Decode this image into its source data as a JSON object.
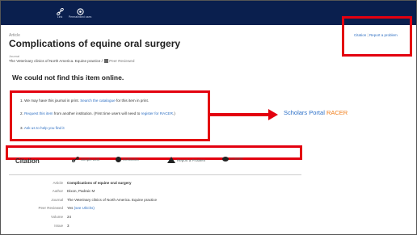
{
  "topbar": {
    "link_label": "Link",
    "permalink_label": "Permalinked uses"
  },
  "article": {
    "type": "Article",
    "title": "Complications of equine oral surgery",
    "journal_label": "Journal",
    "journal": "The Veterinary clinics of North America. Equine practice",
    "journal_sep": " / ",
    "peer_reviewed": "Peer Reviewed"
  },
  "notfound": "We could not find this item online.",
  "citation_links": {
    "citation": "Citation",
    "sep": " | ",
    "report": "Report a problem"
  },
  "options": {
    "o1_text": "1. We may have this journal in print. ",
    "o1_link": "Search the catalogue",
    "o1_tail": " for this item in print.",
    "o2_prefix": "2. ",
    "o2_link": "Request this item",
    "o2_mid": " from another institution. (First time users will need to ",
    "o2_link2": "register for RACER",
    "o2_tail": ".)",
    "o3_prefix": "3. ",
    "o3_link": "Ask us to help you find it"
  },
  "racer": {
    "scholars_portal": "Scholars Portal",
    "racer": "RACER"
  },
  "citation_panel": {
    "title": "Citation",
    "actions": {
      "simple_link": "Simple Link",
      "refworks": "RefWorks",
      "report": "Report a Problem",
      "contact": "Contact"
    },
    "fields": {
      "article_label": "Article",
      "article_value": "Complications of equine oral surgery",
      "author_label": "Author",
      "author_value": "Dixon, Padraic M",
      "journal_label": "Journal",
      "journal_value": "The Veterinary clinics of North America. Equine practice",
      "peer_label": "Peer Reviewed",
      "peer_value": "Yes",
      "peer_link": "(see Ulrichs)",
      "volume_label": "Volume",
      "volume_value": "24",
      "issue_label": "Issue",
      "issue_value": "3"
    }
  },
  "colors": {
    "topbar": "#0a1f4e",
    "annotation_red": "#e3000f",
    "link_blue": "#2e6fc2",
    "scholars_portal_blue": "#2b6fc7",
    "racer_orange": "#f07f1c"
  },
  "icons": [
    "link-icon",
    "permalink-icon",
    "peer-reviewed-icon",
    "simple-link-icon",
    "refworks-icon",
    "warning-icon",
    "chat-bubble-icon"
  ]
}
